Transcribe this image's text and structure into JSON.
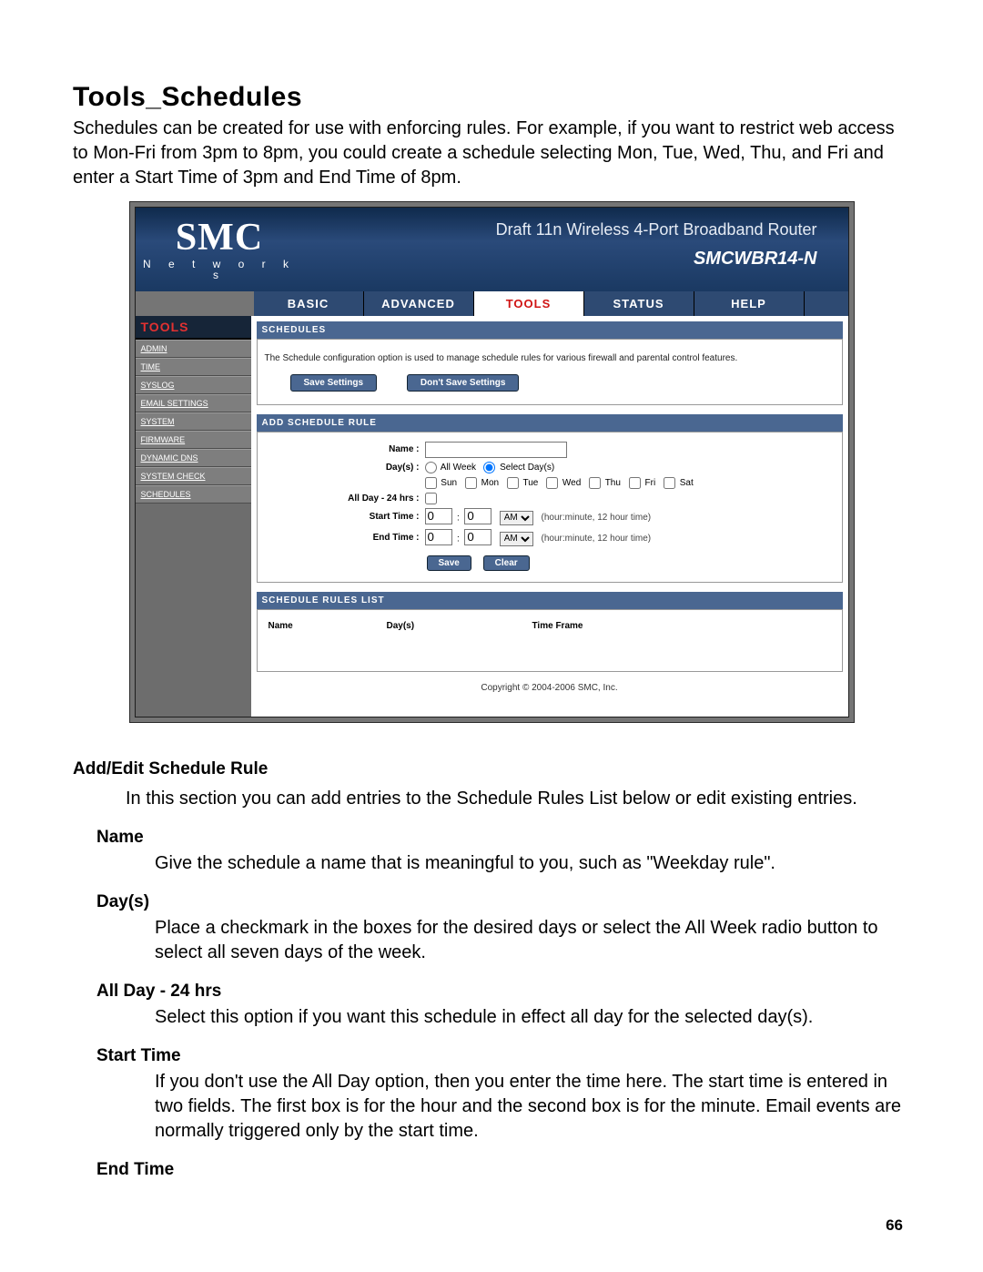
{
  "doc": {
    "title": "Tools_Schedules",
    "intro": "Schedules can be created for use with enforcing rules. For example, if you want to restrict web access to Mon-Fri from 3pm to 8pm, you could create a schedule selecting Mon, Tue, Wed, Thu, and Fri and enter a Start Time of 3pm and End Time of 8pm.",
    "page_number": "66"
  },
  "banner": {
    "logo_main": "SMC",
    "logo_sub": "N e t w o r k s",
    "title": "Draft 11n Wireless 4-Port Broadband Router",
    "model": "SMCWBR14-N"
  },
  "tabs": {
    "basic": "BASIC",
    "advanced": "ADVANCED",
    "tools": "TOOLS",
    "status": "STATUS",
    "help": "HELP"
  },
  "sidebar": {
    "heading": "TOOLS",
    "items": [
      "ADMIN",
      "TIME",
      "SYSLOG",
      "EMAIL SETTINGS",
      "SYSTEM",
      "FIRMWARE",
      "DYNAMIC DNS",
      "SYSTEM CHECK",
      "SCHEDULES"
    ]
  },
  "schedules_panel": {
    "head": "SCHEDULES",
    "desc": "The Schedule configuration option is used to manage schedule rules for various firewall and parental control features.",
    "save_btn": "Save Settings",
    "dont_save_btn": "Don't Save Settings"
  },
  "add_rule": {
    "head": "ADD SCHEDULE RULE",
    "name_label": "Name :",
    "days_label": "Day(s) :",
    "all_week": "All Week",
    "select_days": "Select Day(s)",
    "day_names": [
      "Sun",
      "Mon",
      "Tue",
      "Wed",
      "Thu",
      "Fri",
      "Sat"
    ],
    "all_day_label": "All Day - 24 hrs :",
    "start_label": "Start Time :",
    "end_label": "End Time :",
    "start_hour": "0",
    "start_min": "0",
    "start_ampm": "AM",
    "end_hour": "0",
    "end_min": "0",
    "end_ampm": "AM",
    "time_hint": "(hour:minute, 12 hour time)",
    "save_btn": "Save",
    "clear_btn": "Clear"
  },
  "rules_list": {
    "head": "SCHEDULE RULES LIST",
    "col_name": "Name",
    "col_days": "Day(s)",
    "col_time": "Time Frame"
  },
  "copyright": "Copyright © 2004-2006 SMC, Inc.",
  "explain": {
    "h_add": "Add/Edit Schedule Rule",
    "p_add": "In this section you can add entries to the Schedule Rules List below or edit existing entries.",
    "h_name": "Name",
    "p_name": "Give the schedule a name that is meaningful to you, such as \"Weekday rule\".",
    "h_days": "Day(s)",
    "p_days": "Place a checkmark in the boxes for the desired days or select the All Week radio button to select all seven days of the week.",
    "h_allday": "All Day - 24 hrs",
    "p_allday": "Select this option if you want this schedule in effect all day for the selected day(s).",
    "h_start": "Start Time",
    "p_start": "If you don't use the All Day option, then you enter the time here. The start time is entered in two fields. The first box is for the hour and the second box is for the minute. Email events are normally triggered only by the start time.",
    "h_end": "End Time"
  }
}
